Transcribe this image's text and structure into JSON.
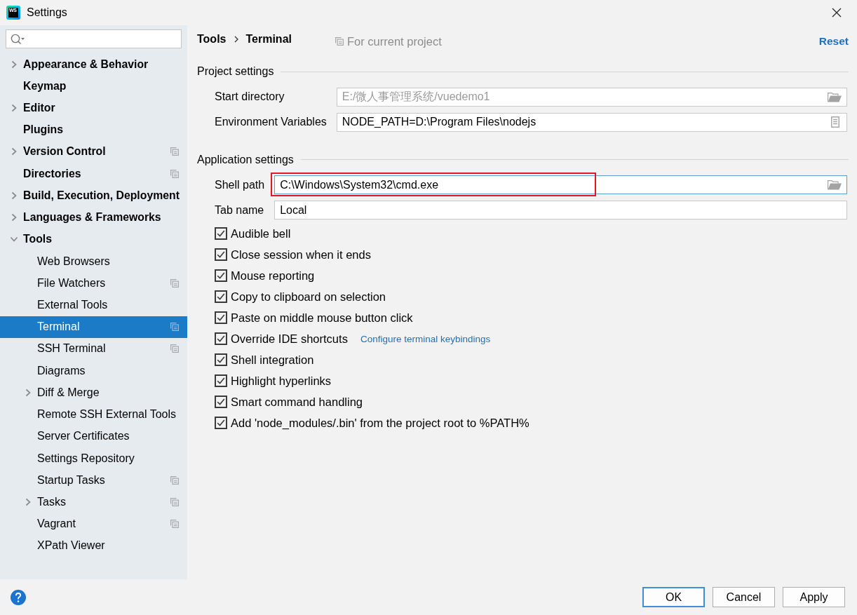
{
  "window": {
    "title": "Settings",
    "logo_text": "WS"
  },
  "sidebar": {
    "items": [
      {
        "label": "Appearance & Behavior",
        "expandable": true,
        "expanded": false,
        "project_level": false,
        "selected": false
      },
      {
        "label": "Keymap",
        "expandable": false,
        "expanded": false,
        "project_level": false,
        "selected": false
      },
      {
        "label": "Editor",
        "expandable": true,
        "expanded": false,
        "project_level": false,
        "selected": false
      },
      {
        "label": "Plugins",
        "expandable": false,
        "expanded": false,
        "project_level": false,
        "selected": false
      },
      {
        "label": "Version Control",
        "expandable": true,
        "expanded": false,
        "project_level": true,
        "selected": false
      },
      {
        "label": "Directories",
        "expandable": false,
        "expanded": false,
        "project_level": true,
        "selected": false
      },
      {
        "label": "Build, Execution, Deployment",
        "expandable": true,
        "expanded": false,
        "project_level": false,
        "selected": false
      },
      {
        "label": "Languages & Frameworks",
        "expandable": true,
        "expanded": false,
        "project_level": false,
        "selected": false
      },
      {
        "label": "Tools",
        "expandable": true,
        "expanded": true,
        "project_level": false,
        "selected": false,
        "children": [
          {
            "label": "Web Browsers",
            "expandable": false,
            "expanded": false,
            "project_level": false,
            "selected": false
          },
          {
            "label": "File Watchers",
            "expandable": false,
            "expanded": false,
            "project_level": true,
            "selected": false
          },
          {
            "label": "External Tools",
            "expandable": false,
            "expanded": false,
            "project_level": false,
            "selected": false
          },
          {
            "label": "Terminal",
            "expandable": false,
            "expanded": false,
            "project_level": true,
            "selected": true
          },
          {
            "label": "SSH Terminal",
            "expandable": false,
            "expanded": false,
            "project_level": true,
            "selected": false
          },
          {
            "label": "Diagrams",
            "expandable": false,
            "expanded": false,
            "project_level": false,
            "selected": false
          },
          {
            "label": "Diff & Merge",
            "expandable": true,
            "expanded": false,
            "project_level": false,
            "selected": false
          },
          {
            "label": "Remote SSH External Tools",
            "expandable": false,
            "expanded": false,
            "project_level": false,
            "selected": false
          },
          {
            "label": "Server Certificates",
            "expandable": false,
            "expanded": false,
            "project_level": false,
            "selected": false
          },
          {
            "label": "Settings Repository",
            "expandable": false,
            "expanded": false,
            "project_level": false,
            "selected": false
          },
          {
            "label": "Startup Tasks",
            "expandable": false,
            "expanded": false,
            "project_level": true,
            "selected": false
          },
          {
            "label": "Tasks",
            "expandable": true,
            "expanded": false,
            "project_level": true,
            "selected": false
          },
          {
            "label": "Vagrant",
            "expandable": false,
            "expanded": false,
            "project_level": true,
            "selected": false
          },
          {
            "label": "XPath Viewer",
            "expandable": false,
            "expanded": false,
            "project_level": false,
            "selected": false
          }
        ]
      }
    ]
  },
  "header": {
    "breadcrumb": [
      "Tools",
      "Terminal"
    ],
    "scope_note": "For current project",
    "reset": "Reset"
  },
  "sections": [
    {
      "title": "Project settings",
      "fields": [
        {
          "label": "Start directory",
          "kind": "path",
          "placeholder": "E:/微人事管理系统/vuedemo1",
          "focused": false,
          "highlighted": false
        },
        {
          "label": "Environment Variables",
          "kind": "env",
          "value": "NODE_PATH=D:\\Program Files\\nodejs",
          "focused": false,
          "highlighted": false
        }
      ]
    },
    {
      "title": "Application settings",
      "fields": [
        {
          "label": "Shell path",
          "kind": "path",
          "value": "C:\\Windows\\System32\\cmd.exe",
          "focused": true,
          "highlighted": true
        },
        {
          "label": "Tab name",
          "kind": "text",
          "value": "Local",
          "focused": false,
          "highlighted": false
        }
      ],
      "checkboxes": [
        {
          "label": "Audible bell",
          "checked": true
        },
        {
          "label": "Close session when it ends",
          "checked": true
        },
        {
          "label": "Mouse reporting",
          "checked": true
        },
        {
          "label": "Copy to clipboard on selection",
          "checked": true
        },
        {
          "label": "Paste on middle mouse button click",
          "checked": true
        },
        {
          "label": "Override IDE shortcuts",
          "checked": true,
          "link": "Configure terminal keybindings"
        },
        {
          "label": "Shell integration",
          "checked": true
        },
        {
          "label": "Highlight hyperlinks",
          "checked": true
        },
        {
          "label": "Smart command handling",
          "checked": true
        },
        {
          "label": "Add 'node_modules/.bin' from the project root to %PATH%",
          "checked": true
        }
      ]
    }
  ],
  "buttons": [
    {
      "label": "OK",
      "focused": true
    },
    {
      "label": "Cancel",
      "focused": false
    },
    {
      "label": "Apply",
      "focused": false
    }
  ]
}
